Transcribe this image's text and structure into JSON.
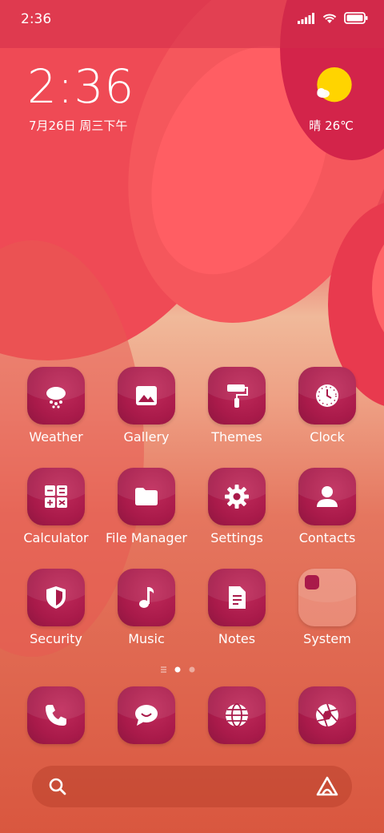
{
  "status_bar": {
    "time": "2:36"
  },
  "clock_widget": {
    "time": "2:36",
    "date": "7月26日 周三下午"
  },
  "weather_widget": {
    "condition": "晴",
    "temperature": "26℃"
  },
  "apps": [
    {
      "label": "Weather",
      "icon": "weather-icon"
    },
    {
      "label": "Gallery",
      "icon": "gallery-icon"
    },
    {
      "label": "Themes",
      "icon": "paint-roller-icon"
    },
    {
      "label": "Clock",
      "icon": "clock-icon"
    },
    {
      "label": "Calculator",
      "icon": "calculator-icon"
    },
    {
      "label": "File Manager",
      "icon": "folder-icon"
    },
    {
      "label": "Settings",
      "icon": "gear-icon"
    },
    {
      "label": "Contacts",
      "icon": "contact-icon"
    },
    {
      "label": "Security",
      "icon": "shield-icon"
    },
    {
      "label": "Music",
      "icon": "music-note-icon"
    },
    {
      "label": "Notes",
      "icon": "notes-icon"
    },
    {
      "label": "System",
      "icon": "folder-group-icon"
    }
  ],
  "dock": [
    {
      "icon": "phone-icon"
    },
    {
      "icon": "messages-icon"
    },
    {
      "icon": "browser-globe-icon"
    },
    {
      "icon": "camera-aperture-icon"
    }
  ],
  "page_indicator": {
    "pages": 2,
    "current": 1
  },
  "colors": {
    "icon_bg": "#a91a4a",
    "sun": "#ffd400"
  }
}
